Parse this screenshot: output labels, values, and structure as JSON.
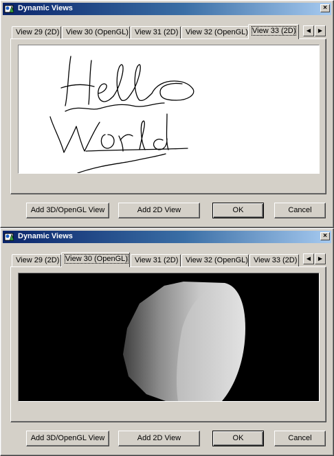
{
  "windows": [
    {
      "title": "Dynamic Views",
      "close_glyph": "×",
      "tabs": [
        "View 29 (2D)",
        "View 30 (OpenGL)",
        "View 31 (2D)",
        "View 32 (OpenGL)",
        "View 33 (2D)"
      ],
      "selected_tab": "View 33 (2D)",
      "view_content": "handwritten 'Hello World' drawing on white canvas",
      "buttons": {
        "add_3d": "Add 3D/OpenGL View",
        "add_2d": "Add 2D View",
        "ok": "OK",
        "cancel": "Cancel"
      }
    },
    {
      "title": "Dynamic Views",
      "close_glyph": "×",
      "tabs": [
        "View 29 (2D)",
        "View 30 (OpenGL)",
        "View 31 (2D)",
        "View 32 (OpenGL)",
        "View 33 (2D)"
      ],
      "selected_tab": "View 30 (OpenGL)",
      "view_content": "shaded grey 3D cylinder on black background",
      "buttons": {
        "add_3d": "Add 3D/OpenGL View",
        "add_2d": "Add 2D View",
        "ok": "OK",
        "cancel": "Cancel"
      }
    }
  ],
  "icons": {
    "app": "app-icon",
    "close": "close-icon",
    "scroll_left": "arrow-left-icon",
    "scroll_right": "arrow-right-icon"
  },
  "colors": {
    "title_gradient_start": "#0a246a",
    "title_gradient_end": "#a6caf0",
    "face": "#d4d0c8"
  }
}
